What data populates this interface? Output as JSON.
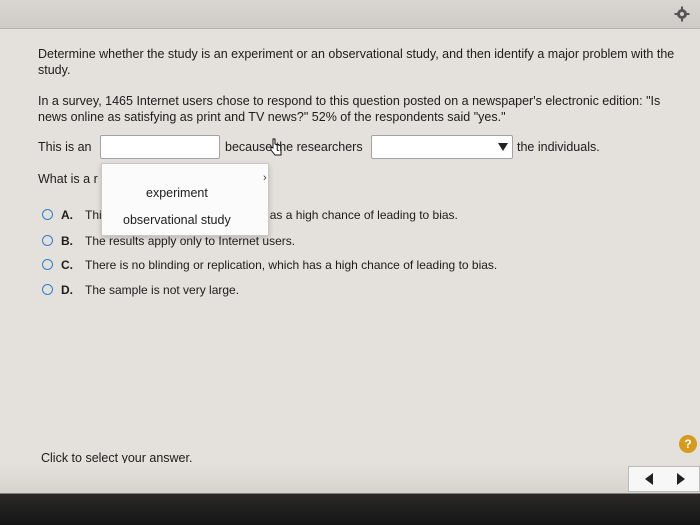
{
  "question": {
    "prompt": "Determine whether the study is an experiment or an observational study, and then identify a major problem with the study.",
    "scenario": "In a survey, 1465 Internet users chose to respond to this question posted on a newspaper's electronic edition: \"Is news online as satisfying as print and TV news?\" 52% of the respondents said \"yes.\""
  },
  "sentence": {
    "part1": "This is an",
    "part2": "because the researchers",
    "part3": "the individuals.",
    "select1_value": "",
    "select2_value": ""
  },
  "dropdown": {
    "options": [
      "experiment",
      "observational study"
    ]
  },
  "followup": {
    "what_is_a": "What is a r"
  },
  "choices": [
    {
      "letter": "A.",
      "text": "Thi                                              ith voluntary response, which has a high chance of leading to bias."
    },
    {
      "letter": "B.",
      "text": "The results apply only to Internet users."
    },
    {
      "letter": "C.",
      "text": "There is no blinding or replication, which has a high chance of leading to bias."
    },
    {
      "letter": "D.",
      "text": "The sample is not very large."
    }
  ],
  "footer": {
    "hint": "Click to select your answer.",
    "help_label": "?"
  },
  "icons": {
    "settings": "gear-icon",
    "help": "question-icon",
    "prev": "left-arrow-icon",
    "next": "right-arrow-icon"
  },
  "colors": {
    "radio": "#2f7fd0",
    "help": "#d59a1f"
  }
}
